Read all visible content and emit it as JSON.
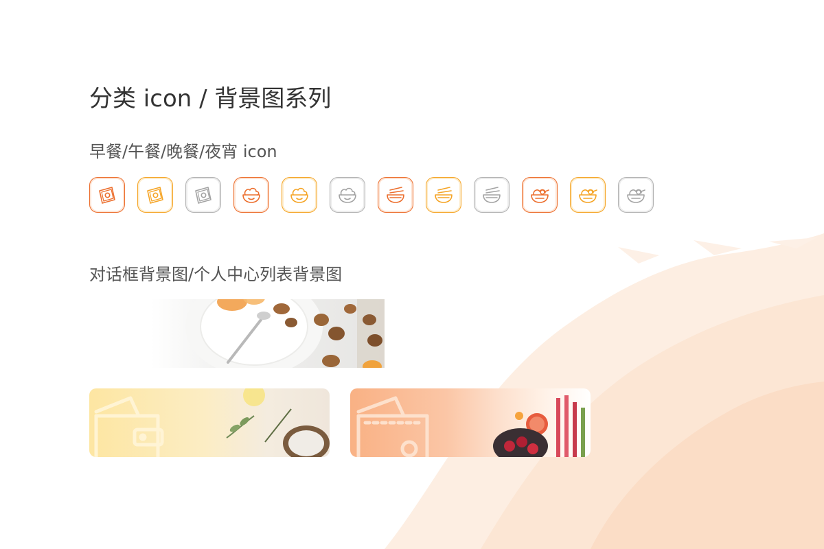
{
  "header": {
    "title": "分类 icon / 背景图系列"
  },
  "icons_section": {
    "heading": "早餐/午餐/晚餐/夜宵 icon",
    "icons": [
      {
        "name": "breakfast-toast-icon",
        "meal": "早餐",
        "tone": "orange",
        "color": "#ec6e2d"
      },
      {
        "name": "breakfast-toast-icon",
        "meal": "早餐",
        "tone": "gold",
        "color": "#f5a425"
      },
      {
        "name": "breakfast-toast-icon",
        "meal": "早餐",
        "tone": "gray",
        "color": "#a3a3a3"
      },
      {
        "name": "lunch-bowl-icon",
        "meal": "午餐",
        "tone": "orange",
        "color": "#ec6e2d"
      },
      {
        "name": "lunch-bowl-icon",
        "meal": "午餐",
        "tone": "gold",
        "color": "#f5a425"
      },
      {
        "name": "lunch-bowl-icon",
        "meal": "午餐",
        "tone": "gray",
        "color": "#a3a3a3"
      },
      {
        "name": "dinner-noodle-bowl-icon",
        "meal": "晚餐",
        "tone": "orange",
        "color": "#ec6e2d"
      },
      {
        "name": "dinner-noodle-bowl-icon",
        "meal": "晚餐",
        "tone": "gold",
        "color": "#f5a425"
      },
      {
        "name": "dinner-noodle-bowl-icon",
        "meal": "晚餐",
        "tone": "gray",
        "color": "#a3a3a3"
      },
      {
        "name": "late-night-snack-bowl-icon",
        "meal": "夜宵",
        "tone": "orange",
        "color": "#ec6e2d"
      },
      {
        "name": "late-night-snack-bowl-icon",
        "meal": "夜宵",
        "tone": "gold",
        "color": "#f5a425"
      },
      {
        "name": "late-night-snack-bowl-icon",
        "meal": "夜宵",
        "tone": "gray",
        "color": "#a3a3a3"
      }
    ]
  },
  "backgrounds_section": {
    "heading": "对话框背景图/个人中心列表背景图",
    "dialog_background": {
      "name": "dialog-background-image",
      "palette": [
        "#ffffff",
        "#e6e5e3",
        "#f0a23c",
        "#8a5a33"
      ]
    },
    "list_backgrounds": [
      {
        "name": "list-background-yellow",
        "palette": [
          "#fde6a2",
          "#efe6db"
        ],
        "icon": "wallet-outline-icon"
      },
      {
        "name": "list-background-orange",
        "palette": [
          "#f9b184",
          "#ffffff"
        ],
        "icon": "wallet-outline-icon"
      }
    ]
  },
  "colors": {
    "title": "#333333",
    "subtitle": "#555555",
    "accent_orange": "#ec6e2d",
    "accent_gold": "#f5a425",
    "neutral_gray": "#a3a3a3",
    "splash": "#fde8d8"
  }
}
